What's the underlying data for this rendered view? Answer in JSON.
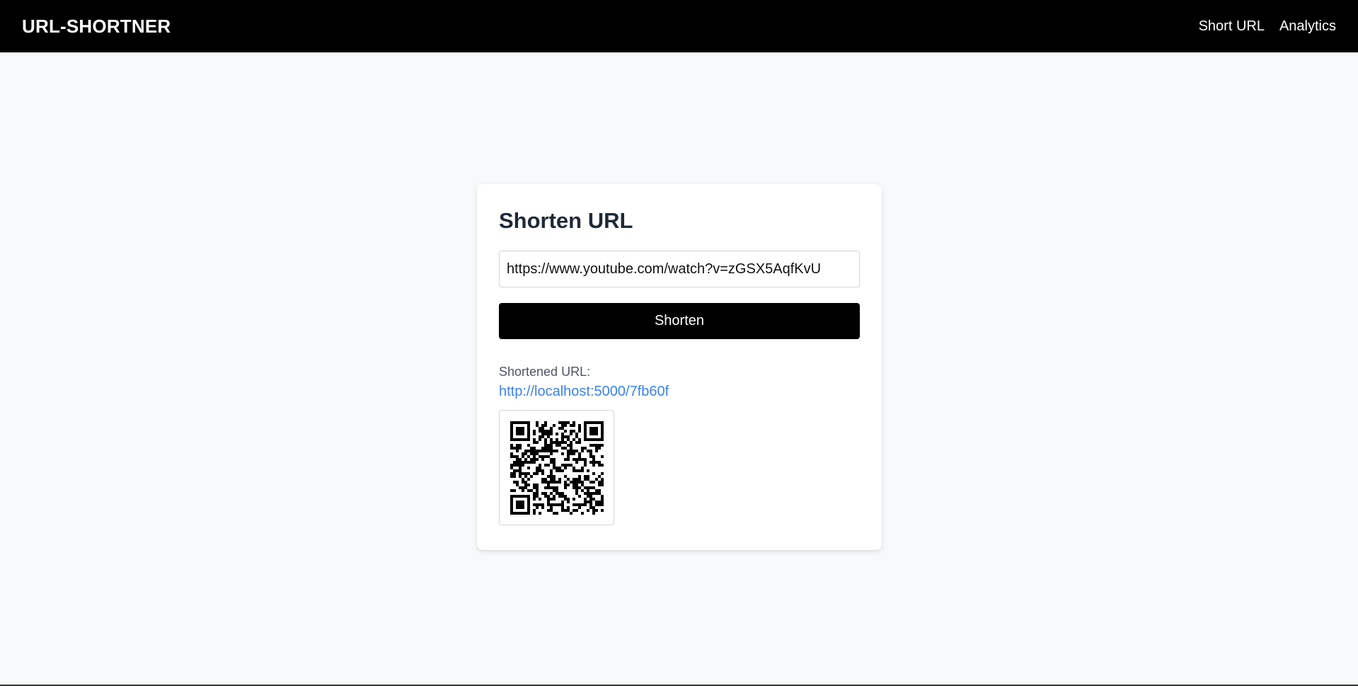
{
  "navbar": {
    "brand": "URL-SHORTNER",
    "links": [
      {
        "label": "Short URL"
      },
      {
        "label": "Analytics"
      }
    ]
  },
  "card": {
    "title": "Shorten URL",
    "input_value": "https://www.youtube.com/watch?v=zGSX5AqfKvU",
    "button_label": "Shorten",
    "result_label": "Shortened URL:",
    "result_link": "http://localhost:5000/7fb60f"
  },
  "colors": {
    "navbar_bg": "#000000",
    "page_bg": "#f8f9fa",
    "link": "#3b82f6",
    "button_bg": "#000000"
  },
  "icons": [
    "qr-code-icon"
  ]
}
